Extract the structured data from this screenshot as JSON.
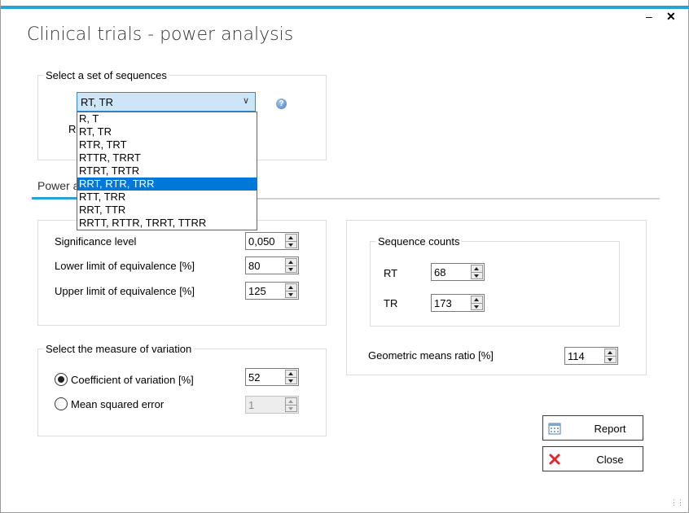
{
  "window": {
    "title": "Clinical trials - power analysis",
    "minimize_glyph": "–",
    "close_glyph": "✕",
    "accent_color": "#2aa1d3"
  },
  "sequences": {
    "legend": "Select a set of sequences",
    "selected": "RT, TR",
    "options": [
      "R, T",
      "RT, TR",
      "RTR, TRT",
      "RTTR, TRRT",
      "RTRT, TRTR",
      "RRT, RTR, TRR",
      "RTT, TRR",
      "RRT, TTR",
      "RRTT, RTTR, TRRT, TTRR"
    ],
    "highlighted_option": "RRT, RTR, TRR",
    "partial_label": "R",
    "help_icon": "question-icon"
  },
  "tab": {
    "label": "Power a"
  },
  "parameters": {
    "significance_label": "Significance level",
    "significance_value": "0,050",
    "lower_label": "Lower limit of equivalence [%]",
    "lower_value": "80",
    "upper_label": "Upper limit of equivalence [%]",
    "upper_value": "125"
  },
  "variation": {
    "legend": "Select the measure of variation",
    "cv_label": "Coefficient of variation [%]",
    "cv_value": "52",
    "mse_label": "Mean squared error",
    "mse_value": "1",
    "selected": "cv"
  },
  "counts": {
    "legend": "Sequence counts",
    "rows": [
      {
        "label": "RT",
        "value": "68"
      },
      {
        "label": "TR",
        "value": "173"
      }
    ],
    "gmr_label": "Geometric means ratio [%]",
    "gmr_value": "114"
  },
  "buttons": {
    "report_label": "Report",
    "report_icon": "calendar-icon",
    "close_label": "Close",
    "close_icon": "red-x-icon"
  }
}
